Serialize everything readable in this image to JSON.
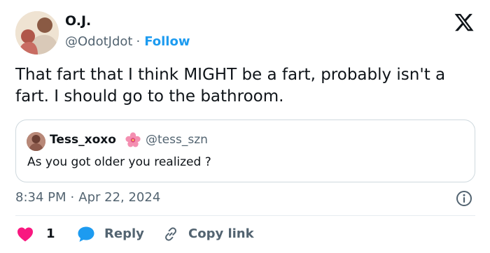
{
  "author": {
    "name": "O.J.",
    "handle": "@OdotJdot",
    "separator": "·",
    "follow_label": "Follow"
  },
  "tweet": {
    "text": "That fart that I think MIGHT be a fart, probably isn't a fart. I should go to the bathroom."
  },
  "quote": {
    "name": "Tess_xoxo",
    "handle": "@tess_szn",
    "text": "As you got older you realized ?",
    "name_emoji": "hibiscus-flower"
  },
  "meta": {
    "time": "8:34 PM",
    "separator": "·",
    "date": "Apr 22, 2024"
  },
  "actions": {
    "like_count": "1",
    "reply_label": "Reply",
    "copy_link_label": "Copy link"
  },
  "colors": {
    "accent": "#1d9bf0",
    "like": "#f91880",
    "muted_text": "#536471",
    "text": "#0f1419",
    "border": "#cfd9de"
  },
  "icons": {
    "brand": "x-logo-icon",
    "info": "info-icon",
    "like": "heart-icon",
    "reply": "speech-bubble-icon",
    "copy": "link-icon"
  }
}
